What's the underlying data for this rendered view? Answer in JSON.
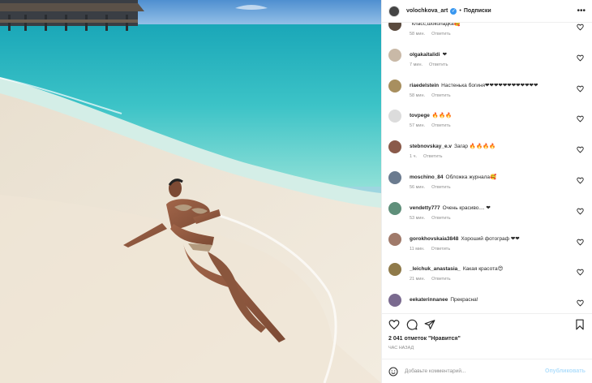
{
  "header": {
    "username": "volochkova_art",
    "separator": "•",
    "follow_label": "Подписки",
    "more_label": "•••"
  },
  "comments": [
    {
      "user": "",
      "text": "класс,шоколадка🥰",
      "time": "58 мин.",
      "reply": "Ответить",
      "avatar_color": "#5a4a3e"
    },
    {
      "user": "olgakaitalidi",
      "text": "❤",
      "time": "7 мин.",
      "reply": "Ответить",
      "avatar_color": "#c9b9a7"
    },
    {
      "user": "riaedelstein",
      "text": "Настенька богиня❤❤❤❤❤❤❤❤❤❤❤❤",
      "time": "58 мин.",
      "reply": "Ответить",
      "avatar_color": "#a88f5f"
    },
    {
      "user": "tovpege",
      "text": "🔥🔥🔥",
      "time": "57 мин.",
      "reply": "Ответить",
      "avatar_color": "#dcdcdc"
    },
    {
      "user": "stebnovskay_e.v",
      "text": "Загар 🔥🔥🔥🔥",
      "time": "1 ч.",
      "reply": "Ответить",
      "avatar_color": "#8a5a4a"
    },
    {
      "user": "moschino_84",
      "text": "Обложка журнала🥰",
      "time": "56 мин.",
      "reply": "Ответить",
      "avatar_color": "#6b7b8f"
    },
    {
      "user": "vendetty777",
      "text": "Очень красиво.... ❤",
      "time": "53 мин.",
      "reply": "Ответить",
      "avatar_color": "#5f8f7a"
    },
    {
      "user": "gorokhovskaia3848",
      "text": "Хороший фотограф ❤❤",
      "time": "11 мин.",
      "reply": "Ответить",
      "avatar_color": "#a07a6a"
    },
    {
      "user": "_leichuk_anastasia_",
      "text": "Какая красота😍",
      "time": "21 мин.",
      "reply": "Ответить",
      "avatar_color": "#8f7a4a"
    },
    {
      "user": "eekaterinnanee",
      "text": "Прекрасна!",
      "time": "",
      "reply": "",
      "avatar_color": "#7a6a8f"
    }
  ],
  "likes_text": "2 041 отметок \"Нравится\"",
  "time_ago": "час назад",
  "add_comment": {
    "placeholder": "Добавьте комментарий...",
    "publish_label": "Опубликовать"
  },
  "colors": {
    "link_disabled": "#b2dffc",
    "meta": "#8e8e8e",
    "verified": "#3897f0"
  },
  "icons": [
    "heart-icon",
    "comment-icon",
    "share-icon",
    "bookmark-icon",
    "emoji-icon",
    "more-icon"
  ]
}
